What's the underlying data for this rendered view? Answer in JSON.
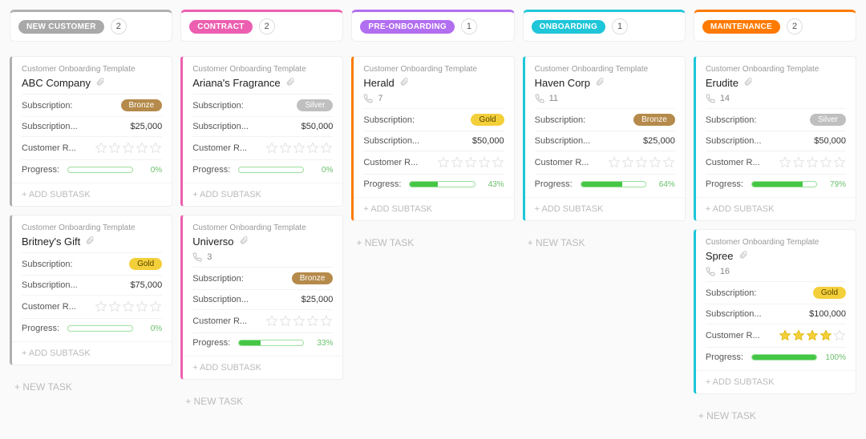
{
  "template_label": "Customer Onboarding Template",
  "add_subtask_label": "+ ADD SUBTASK",
  "new_task_label": "+ NEW TASK",
  "fields": {
    "subscription": "Subscription:",
    "subscription_amount": "Subscription...",
    "customer_rating": "Customer R...",
    "progress": "Progress:"
  },
  "columns": [
    {
      "name": "NEW CUSTOMER",
      "count": "2",
      "color": "gray",
      "cards": [
        {
          "title": "ABC Company",
          "tier": "Bronze",
          "amount": "$25,000",
          "rating": 0,
          "progress": 0
        },
        {
          "title": "Britney's Gift",
          "tier": "Gold",
          "amount": "$75,000",
          "rating": 0,
          "progress": 0
        }
      ]
    },
    {
      "name": "CONTRACT",
      "count": "2",
      "color": "pink",
      "cards": [
        {
          "title": "Ariana's Fragrance",
          "tier": "Silver",
          "amount": "$50,000",
          "rating": 0,
          "progress": 0
        },
        {
          "title": "Universo",
          "phone": "3",
          "tier": "Bronze",
          "amount": "$25,000",
          "rating": 0,
          "progress": 33
        }
      ]
    },
    {
      "name": "PRE-ONBOARDING",
      "count": "1",
      "color": "purple",
      "cards": [
        {
          "title": "Herald",
          "phone": "7",
          "tier": "Gold",
          "amount": "$50,000",
          "rating": 0,
          "progress": 43
        }
      ]
    },
    {
      "name": "ONBOARDING",
      "count": "1",
      "color": "cyan",
      "cards": [
        {
          "title": "Haven Corp",
          "phone": "11",
          "tier": "Bronze",
          "amount": "$25,000",
          "rating": 0,
          "progress": 64
        }
      ]
    },
    {
      "name": "MAINTENANCE",
      "count": "2",
      "color": "orange",
      "cards": [
        {
          "title": "Erudite",
          "phone": "14",
          "tier": "Silver",
          "amount": "$50,000",
          "rating": 0,
          "progress": 79
        },
        {
          "title": "Spree",
          "phone": "16",
          "tier": "Gold",
          "amount": "$100,000",
          "rating": 4,
          "progress": 100
        }
      ]
    }
  ]
}
